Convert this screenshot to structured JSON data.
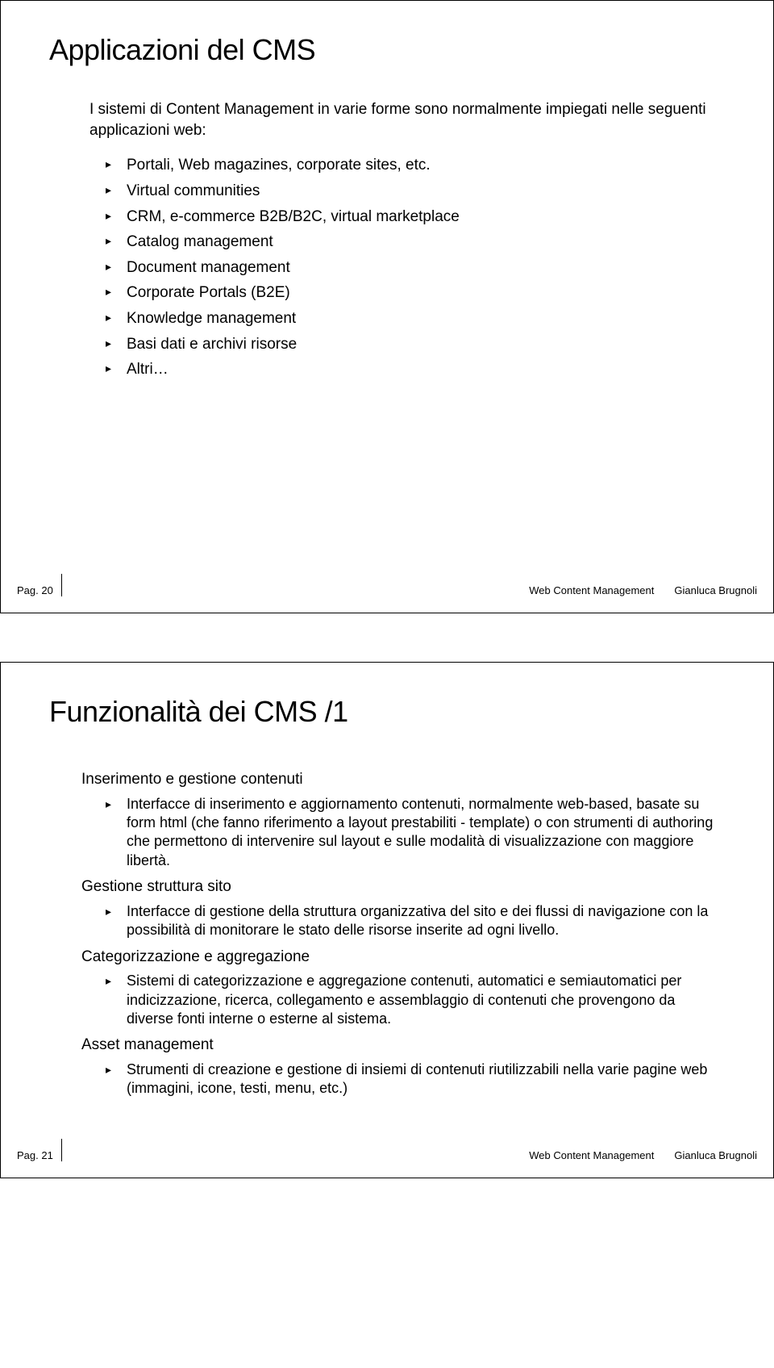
{
  "slide1": {
    "title": "Applicazioni del CMS",
    "intro": "I sistemi di Content Management in varie forme sono normalmente impiegati nelle seguenti applicazioni web:",
    "items": [
      "Portali, Web magazines, corporate sites, etc.",
      "Virtual communities",
      "CRM, e-commerce B2B/B2C, virtual marketplace",
      "Catalog management",
      "Document management",
      "Corporate Portals (B2E)",
      "Knowledge management",
      "Basi dati e archivi risorse",
      "Altri…"
    ],
    "footer": {
      "page": "Pag. 20",
      "center": "Web Content Management",
      "author": "Gianluca Brugnoli"
    }
  },
  "slide2": {
    "title": "Funzionalità dei CMS /1",
    "sections": [
      {
        "label": "Inserimento e gestione contenuti",
        "item": "Interfacce di inserimento e aggiornamento contenuti, normalmente web-based, basate su form html (che fanno riferimento a layout prestabiliti - template) o con strumenti di authoring che permettono di intervenire sul layout e sulle modalità di visualizzazione con maggiore libertà."
      },
      {
        "label": "Gestione struttura sito",
        "item": "Interfacce di gestione della struttura organizzativa del sito e dei flussi di navigazione con la possibilità di monitorare le stato delle risorse inserite ad ogni livello."
      },
      {
        "label": "Categorizzazione e aggregazione",
        "item": "Sistemi di categorizzazione e aggregazione contenuti, automatici e semiautomatici per indicizzazione, ricerca, collegamento e assemblaggio di contenuti che provengono da diverse fonti interne o esterne al sistema."
      },
      {
        "label": "Asset management",
        "item": "Strumenti di creazione e gestione di insiemi di contenuti riutilizzabili nella varie pagine web (immagini, icone, testi, menu, etc.)"
      }
    ],
    "footer": {
      "page": "Pag. 21",
      "center": "Web Content Management",
      "author": "Gianluca Brugnoli"
    }
  }
}
